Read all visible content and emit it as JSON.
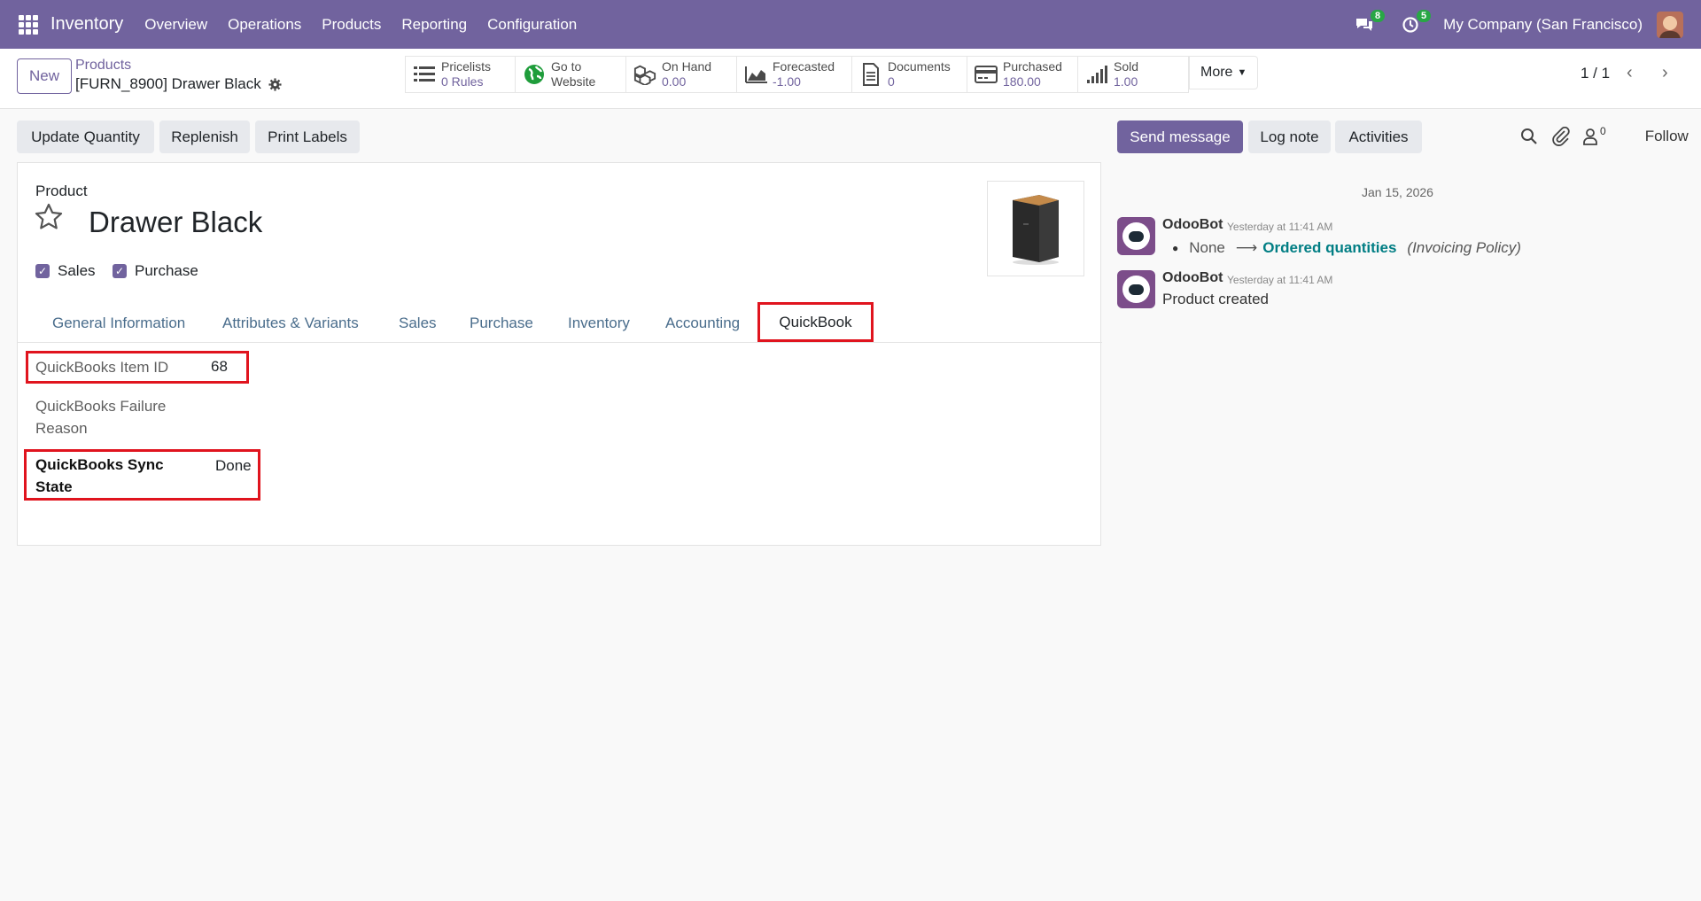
{
  "navbar": {
    "brand": "Inventory",
    "menus": [
      "Overview",
      "Operations",
      "Products",
      "Reporting",
      "Configuration"
    ],
    "messages_count": "8",
    "activities_count": "5",
    "company": "My Company (San Francisco)"
  },
  "control": {
    "new_label": "New",
    "breadcrumb": "Products",
    "record_title": "[FURN_8900] Drawer Black",
    "stats": [
      {
        "label": "Pricelists",
        "value": "0 Rules"
      },
      {
        "label": "Go to",
        "value": "Website"
      },
      {
        "label": "On Hand",
        "value": "0.00"
      },
      {
        "label": "Forecasted",
        "value": "-1.00"
      },
      {
        "label": "Documents",
        "value": "0"
      },
      {
        "label": "Purchased",
        "value": "180.00"
      },
      {
        "label": "Sold",
        "value": "1.00"
      }
    ],
    "more_label": "More",
    "pager": "1 / 1"
  },
  "actions": {
    "update_quantity": "Update Quantity",
    "replenish": "Replenish",
    "print_labels": "Print Labels"
  },
  "form": {
    "product_label": "Product",
    "product_name": "Drawer Black",
    "sales_label": "Sales",
    "purchase_label": "Purchase",
    "tabs": [
      "General Information",
      "Attributes & Variants",
      "Sales",
      "Purchase",
      "Inventory",
      "Accounting",
      "QuickBook"
    ],
    "fields": {
      "item_id_label": "QuickBooks Item ID",
      "item_id_value": "68",
      "failure_label_1": "QuickBooks Failure",
      "failure_label_2": "Reason",
      "sync_label_1": "QuickBooks Sync",
      "sync_label_2": "State",
      "sync_value": "Done"
    }
  },
  "chatter": {
    "send_message": "Send message",
    "log_note": "Log note",
    "activities": "Activities",
    "followers_count": "0",
    "follow": "Follow",
    "date": "Jan 15, 2026",
    "messages": [
      {
        "author": "OdooBot",
        "time": "Yesterday at 11:41 AM",
        "old": "None",
        "new": "Ordered quantities",
        "field": "(Invoicing Policy)"
      },
      {
        "author": "OdooBot",
        "time": "Yesterday at 11:41 AM",
        "text": "Product created"
      }
    ]
  }
}
